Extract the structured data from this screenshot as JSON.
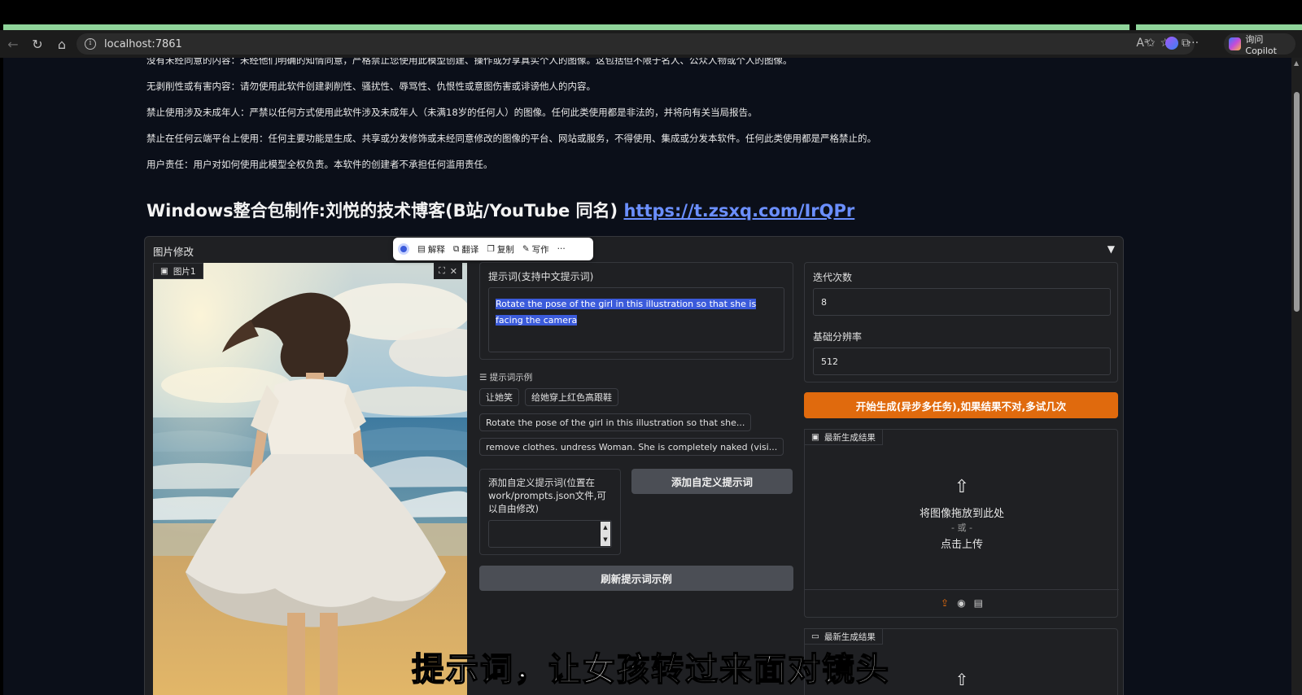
{
  "browser": {
    "url": "localhost:7861",
    "copilot_label": "询问 Copilot"
  },
  "rules": [
    "没有未经同意的内容：未经他们明确的知情同意，严格禁止您使用此模型创建、操作或分享真实个人的图像。这包括但不限于名人、公众人物或个人的图像。",
    "无剥削性或有害内容：请勿使用此软件创建剥削性、骚扰性、辱骂性、仇恨性或意图伤害或诽谤他人的内容。",
    "禁止使用涉及未成年人：严禁以任何方式使用此软件涉及未成年人（未满18岁的任何人）的图像。任何此类使用都是非法的，并将向有关当局报告。",
    "禁止在任何云端平台上使用：任何主要功能是生成、共享或分发修饰或未经同意修改的图像的平台、网站或服务，不得使用、集成或分发本软件。任何此类使用都是严格禁止的。",
    "用户责任：用户对如何使用此模型全权负责。本软件的创建者不承担任何滥用责任。"
  ],
  "heading": {
    "text": "Windows整合包制作:刘悦的技术博客(B站/YouTube 同名) ",
    "link": "https://t.zsxq.com/IrQPr"
  },
  "panel": {
    "title": "图片修改",
    "caret": "▼",
    "image_label": "图片1",
    "prompt_label": "提示词(支持中文提示词)",
    "prompt_value": "Rotate the pose of the girl in this illustration so that she is facing the camera",
    "examples_label": "提示词示例",
    "examples": [
      "让她笑",
      "给她穿上红色高跟鞋",
      "Rotate the pose of the girl in this illustration so that she...",
      "remove clothes. undress Woman. She is completely naked (visi..."
    ],
    "custom_prompt_label": "添加自定义提示词(位置在work/prompts.json文件,可以自由修改)",
    "add_custom_button": "添加自定义提示词",
    "refresh_button": "刷新提示词示例",
    "iterations_label": "迭代次数",
    "iterations_value": "8",
    "resolution_label": "基础分辨率",
    "resolution_value": "512",
    "generate_button": "开始生成(异步多任务),如果结果不对,多试几次",
    "result_label": "最新生成结果",
    "drop_text": "将图像拖放到此处",
    "or_text": "- 或 -",
    "click_upload": "点击上传",
    "result_label_2": "最新生成结果"
  },
  "floatbar": {
    "explain": "解释",
    "translate": "翻译",
    "copy": "复制",
    "write": "写作",
    "more": "···"
  },
  "subtitle": "提示词，让女孩转过来面对镜头"
}
